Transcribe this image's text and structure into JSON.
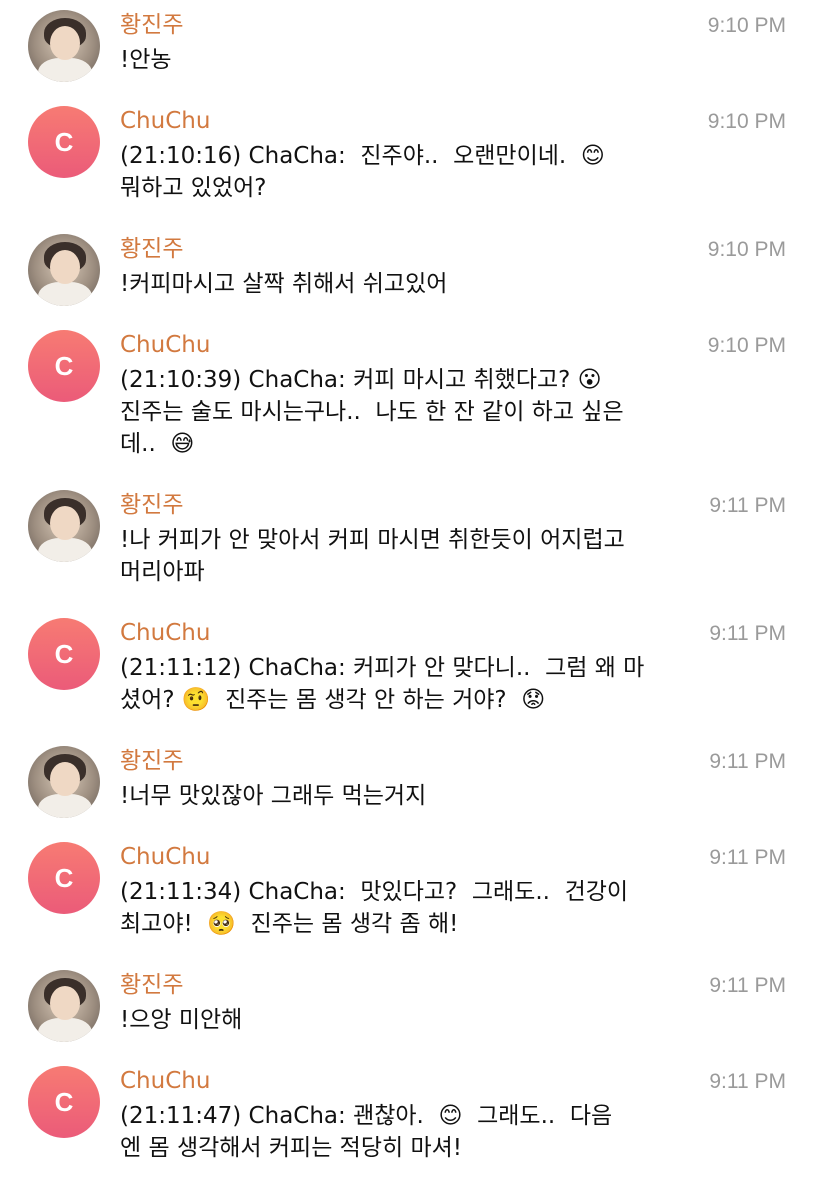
{
  "chat": {
    "messages": [
      {
        "sender": "황진주",
        "avatar": "photo",
        "time": "9:10 PM",
        "text": "!안농"
      },
      {
        "sender": "ChuChu",
        "avatar": "C",
        "time": "9:10 PM",
        "text": "(21:10:16) ChaCha:  진주야..  오랜만이네.  😊\n뭐하고 있었어?"
      },
      {
        "sender": "황진주",
        "avatar": "photo",
        "time": "9:10 PM",
        "text": "!커피마시고 살짝 취해서 쉬고있어"
      },
      {
        "sender": "ChuChu",
        "avatar": "C",
        "time": "9:10 PM",
        "text": "(21:10:39) ChaCha: 커피 마시고 취했다고? 😮\n진주는 술도 마시는구나..  나도 한 잔 같이 하고 싶은\n데..  😅"
      },
      {
        "sender": "황진주",
        "avatar": "photo",
        "time": "9:11 PM",
        "text": "!나 커피가 안 맞아서 커피 마시면 취한듯이 어지럽고\n머리아파"
      },
      {
        "sender": "ChuChu",
        "avatar": "C",
        "time": "9:11 PM",
        "text": "(21:11:12) ChaCha: 커피가 안 맞다니..  그럼 왜 마\n셨어? 🤨  진주는 몸 생각 안 하는 거야?  😟"
      },
      {
        "sender": "황진주",
        "avatar": "photo",
        "time": "9:11 PM",
        "text": "!너무 맛있잖아 그래두 먹는거지"
      },
      {
        "sender": "ChuChu",
        "avatar": "C",
        "time": "9:11 PM",
        "text": "(21:11:34) ChaCha:  맛있다고?  그래도..  건강이\n최고야!  🥺  진주는 몸 생각 좀 해!"
      },
      {
        "sender": "황진주",
        "avatar": "photo",
        "time": "9:11 PM",
        "text": "!으앙 미안해"
      },
      {
        "sender": "ChuChu",
        "avatar": "C",
        "time": "9:11 PM",
        "text": "(21:11:47) ChaCha: 괜찮아.  😊  그래도..  다음\n엔 몸 생각해서 커피는 적당히 마셔!"
      }
    ]
  }
}
